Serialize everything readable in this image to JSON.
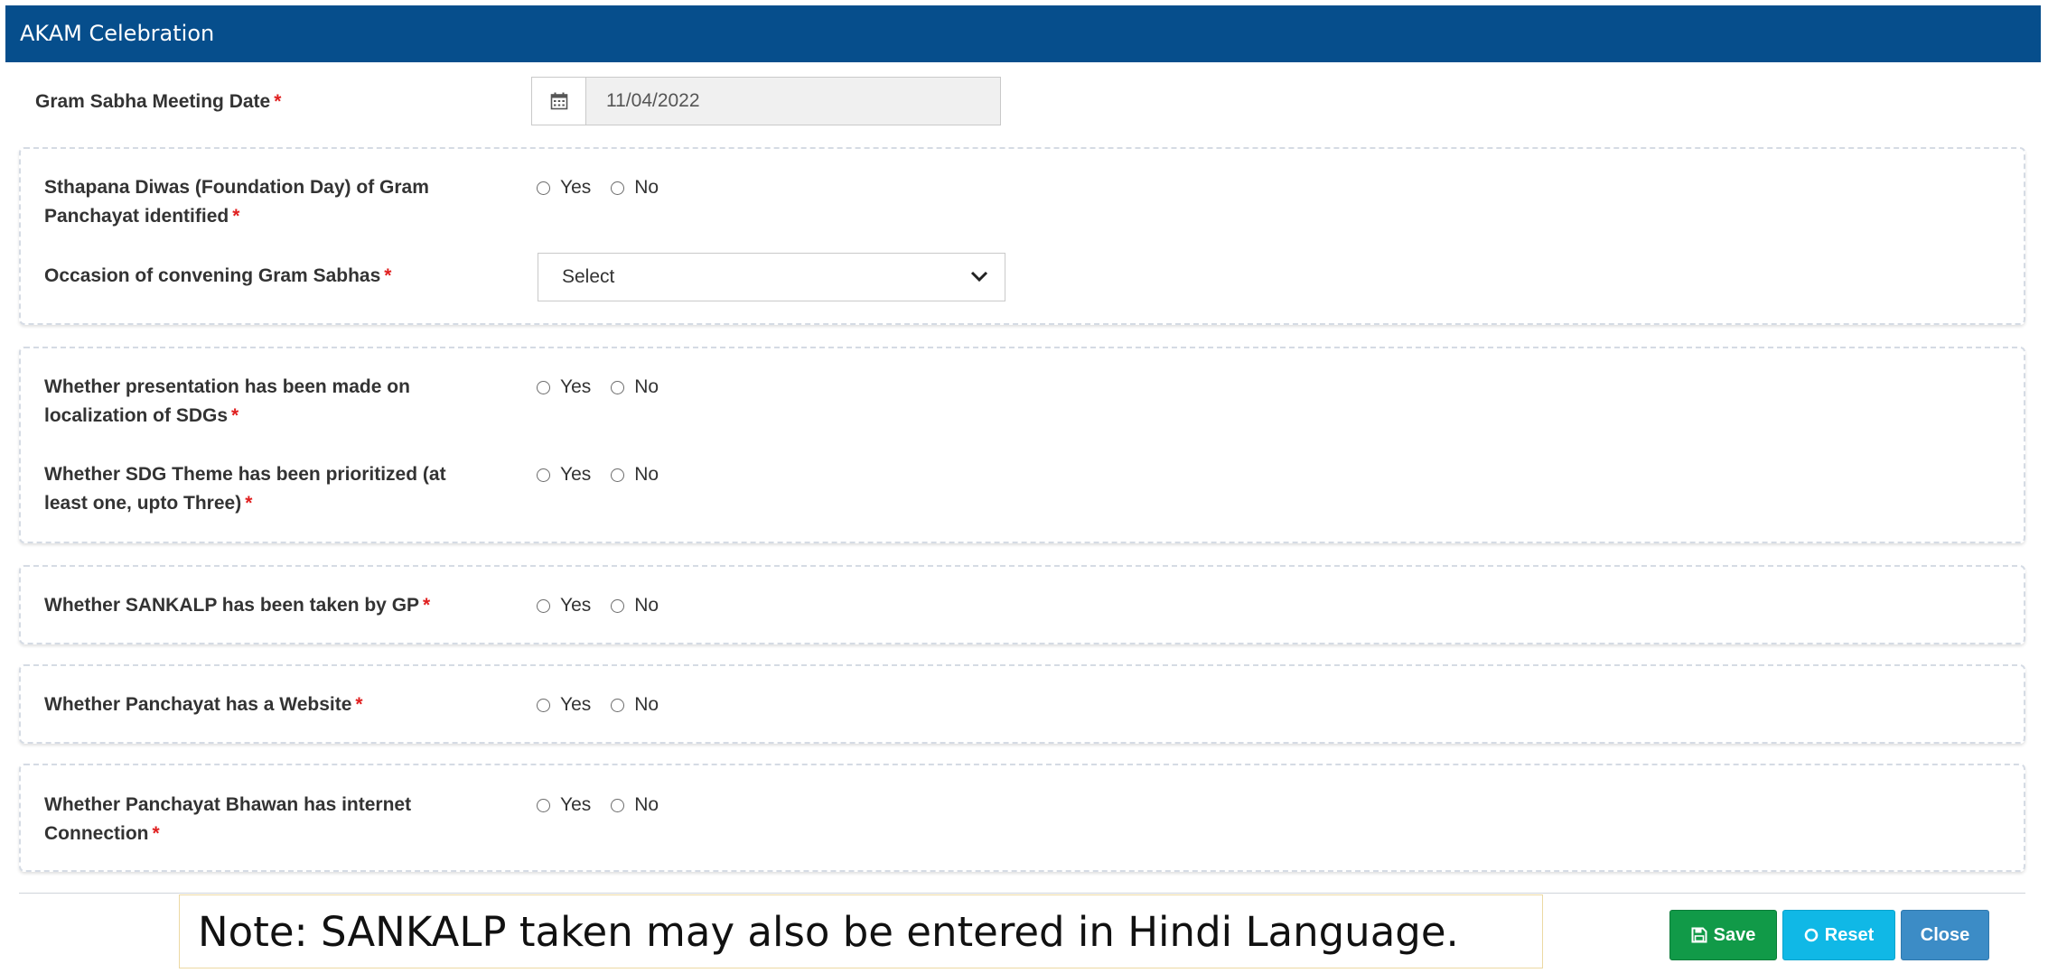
{
  "header": {
    "title": "AKAM Celebration"
  },
  "meeting_date": {
    "label": "Gram Sabha Meeting Date",
    "value": "11/04/2022"
  },
  "fields": {
    "foundation_day": {
      "label_line1": "Sthapana Diwas (Foundation Day) of Gram",
      "label_line2": "Panchayat identified"
    },
    "occasion": {
      "label": "Occasion of convening Gram Sabhas",
      "selected": "Select"
    },
    "presentation_sdg": {
      "label_line1": "Whether presentation has been made on",
      "label_line2": "localization of SDGs"
    },
    "sdg_theme": {
      "label_line1": "Whether SDG Theme has been prioritized (at",
      "label_line2": "least one, upto Three)"
    },
    "sankalp": {
      "label": "Whether SANKALP has been taken by GP"
    },
    "website": {
      "label": "Whether Panchayat has a Website"
    },
    "internet": {
      "label_line1": "Whether Panchayat Bhawan has internet",
      "label_line2": "Connection"
    }
  },
  "radio_options": {
    "yes": "Yes",
    "no": "No"
  },
  "required_marker": "*",
  "note": "Note: SANKALP taken may also be entered in Hindi Language.",
  "buttons": {
    "save": "Save",
    "reset": "Reset",
    "close": "Close"
  },
  "colors": {
    "header": "#064e8c",
    "save": "#119a48",
    "reset": "#10b8e6",
    "close": "#3c8cc6",
    "required": "#e02020"
  }
}
